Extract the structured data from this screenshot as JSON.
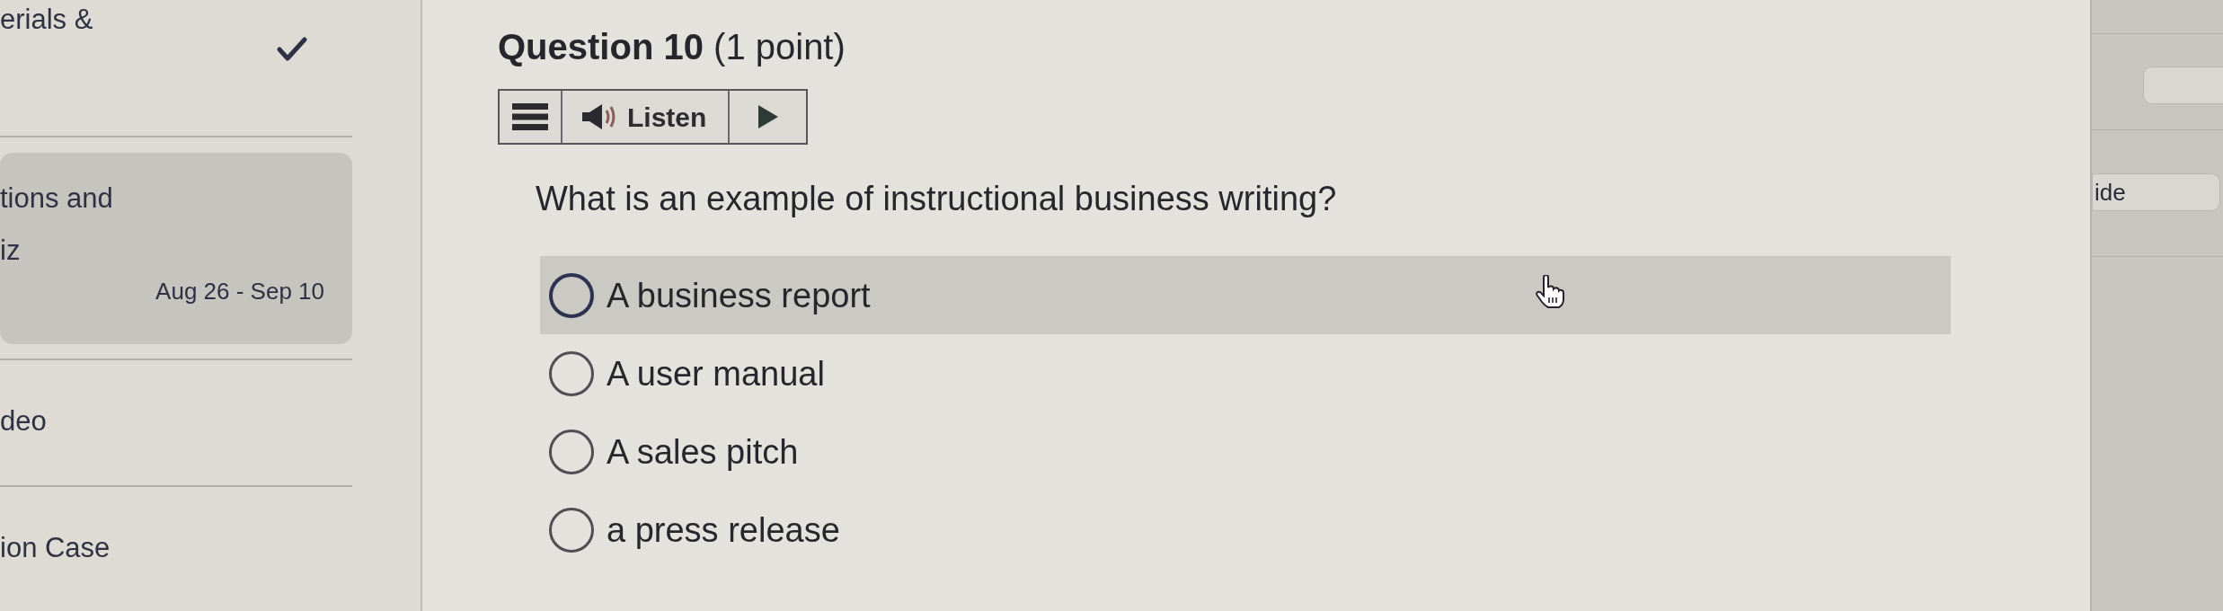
{
  "sidebar": {
    "items": [
      {
        "title": "erials &",
        "completed": true,
        "selected": false
      },
      {
        "title": "tions and\niz",
        "date": "Aug 26 - Sep 10",
        "completed": false,
        "selected": true
      },
      {
        "title": "deo",
        "completed": false,
        "selected": false
      },
      {
        "title": "ion Case",
        "completed": false,
        "selected": false
      }
    ]
  },
  "question": {
    "heading": "**Question 10** (1 point)",
    "toolbar": {
      "listen_label": "Listen"
    },
    "prompt": "What is an example of instructional business writing?",
    "options": [
      {
        "label": "A business report",
        "selected": false,
        "hovered": true
      },
      {
        "label": "A user manual",
        "selected": false,
        "hovered": false
      },
      {
        "label": "A sales pitch",
        "selected": false,
        "hovered": false
      },
      {
        "label": "a press release",
        "selected": false,
        "hovered": false
      }
    ]
  },
  "side_panel": {
    "buttons": [
      "ide"
    ]
  }
}
